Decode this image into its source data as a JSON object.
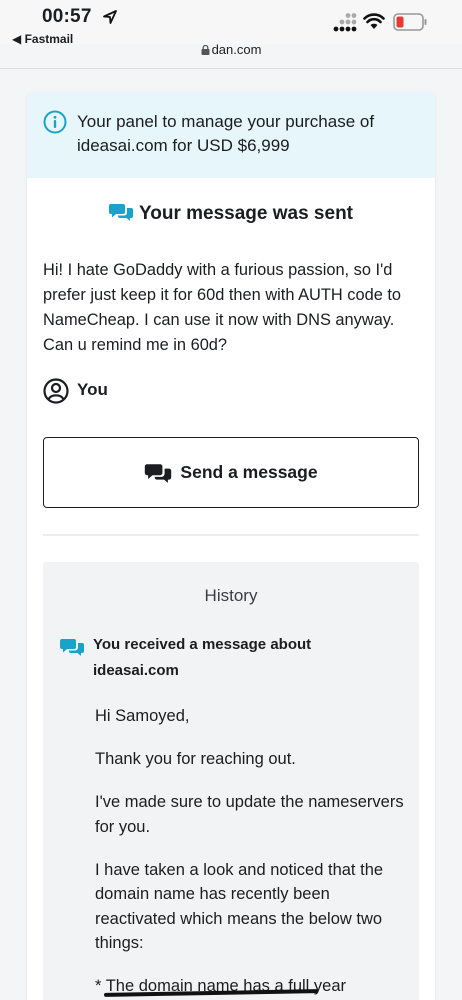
{
  "status_bar": {
    "time": "00:57",
    "back_app": "◀ Fastmail",
    "url": "dan.com"
  },
  "panel": {
    "info_text": "Your panel to manage your purchase of ideasai.com for USD $6,999",
    "sent_title": "Your message was sent",
    "message": "Hi! I hate GoDaddy with a furious passion, so I'd prefer just keep it for 60d then with AUTH code to NameCheap. I can use it now with DNS anyway. Can u remind me in 60d?",
    "author": "You",
    "send_button": "Send a message"
  },
  "history": {
    "title": "History",
    "heading": "You received a message about ideasai.com",
    "paragraphs": [
      "Hi Samoyed,",
      "Thank you for reaching out.",
      "I've made sure to update the nameservers for you.",
      "I have taken a look and noticed that the domain name has recently been reactivated which means the below two things:",
      "* The domain name has a full year"
    ]
  },
  "colors": {
    "accent": "#1aa3c8",
    "banner_bg": "#e6f6fa",
    "text": "#1b1d21",
    "battery_low": "#e53935"
  },
  "icons": [
    "location-arrow-icon",
    "signal-icon",
    "wifi-icon",
    "battery-icon",
    "lock-icon",
    "info-icon",
    "chat-bubbles-icon",
    "user-circle-icon"
  ]
}
